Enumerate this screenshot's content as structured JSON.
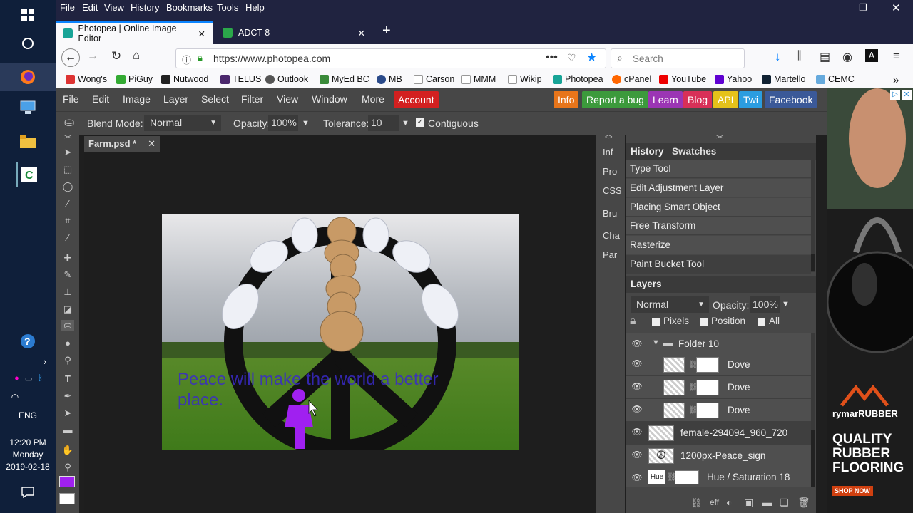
{
  "taskbar": {
    "clock_time": "12:20 PM",
    "clock_day": "Monday",
    "clock_date": "2019-02-18",
    "language": "ENG"
  },
  "browser": {
    "menu": [
      "File",
      "Edit",
      "View",
      "History",
      "Bookmarks",
      "Tools",
      "Help"
    ],
    "tabs": [
      {
        "label": "Photopea | Online Image Editor"
      },
      {
        "label": "ADCT 8"
      }
    ],
    "url": "https://www.photopea.com",
    "search_placeholder": "Search",
    "bookmarks": [
      "Wong's",
      "PiGuy",
      "Nutwood",
      "TELUS",
      "Outlook",
      "MyEd BC",
      "MB",
      "Carson",
      "MMM",
      "Wikip",
      "Photopea",
      "cPanel",
      "YouTube",
      "Yahoo",
      "Martello",
      "CEMC"
    ]
  },
  "photopea": {
    "menu": [
      "File",
      "Edit",
      "Image",
      "Layer",
      "Select",
      "Filter",
      "View",
      "Window",
      "More"
    ],
    "account": "Account",
    "badges": [
      {
        "label": "Info",
        "color": "#e8751a"
      },
      {
        "label": "Report a bug",
        "color": "#3c9a3c"
      },
      {
        "label": "Learn",
        "color": "#9b35b4"
      },
      {
        "label": "Blog",
        "color": "#d83058"
      },
      {
        "label": "API",
        "color": "#e5c21a"
      },
      {
        "label": "Twi",
        "color": "#2b9de0"
      },
      {
        "label": "Facebook",
        "color": "#3b5998"
      }
    ],
    "options": {
      "blend_label": "Blend Mode:",
      "blend_value": "Normal",
      "opacity_label": "Opacity:",
      "opacity_value": "100%",
      "tolerance_label": "Tolerance:",
      "tolerance_value": "10",
      "contiguous_label": "Contiguous"
    },
    "doc_tab": "Farm.psd *",
    "canvas_text": "Peace will make the world a better place.",
    "mini_panels": [
      "Inf",
      "Pro",
      "CSS",
      "Bru",
      "Cha",
      "Par"
    ],
    "history_tabs": [
      "History",
      "Swatches"
    ],
    "history": [
      "Type Tool",
      "Edit Adjustment Layer",
      "Placing Smart Object",
      "Free Transform",
      "Rasterize",
      "Paint Bucket Tool"
    ],
    "layers_title": "Layers",
    "layers_blend": "Normal",
    "layers_opacity_label": "Opacity:",
    "layers_opacity_value": "100%",
    "lock_options": [
      "Pixels",
      "Position",
      "All"
    ],
    "layers": [
      {
        "name": "Folder 10"
      },
      {
        "name": "Dove"
      },
      {
        "name": "Dove"
      },
      {
        "name": "Dove"
      },
      {
        "name": "female-294094_960_720"
      },
      {
        "name": "1200px-Peace_sign"
      },
      {
        "name": "Hue / Saturation 18"
      }
    ],
    "hue_thumb_label": "Hue",
    "layers_footer_eff": "eff",
    "fg_color": "#a020f0",
    "bg_color": "#ffffff"
  },
  "ad": {
    "brand": "rymarRUBBER",
    "line1": "QUALITY",
    "line2": "RUBBER",
    "line3": "FLOORING",
    "cta": "SHOP NOW"
  }
}
